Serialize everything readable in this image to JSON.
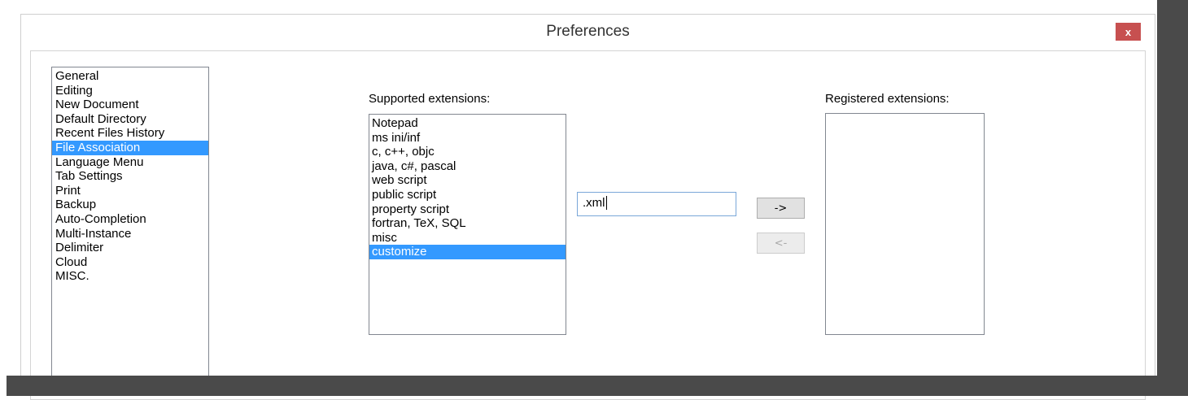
{
  "window": {
    "title": "Preferences",
    "close_label": "x",
    "close_color": "#c75050",
    "selection_color": "#3399ff"
  },
  "categories": {
    "items": [
      {
        "label": "General",
        "selected": false
      },
      {
        "label": "Editing",
        "selected": false
      },
      {
        "label": "New Document",
        "selected": false
      },
      {
        "label": "Default Directory",
        "selected": false
      },
      {
        "label": "Recent Files History",
        "selected": false
      },
      {
        "label": "File Association",
        "selected": true
      },
      {
        "label": "Language Menu",
        "selected": false
      },
      {
        "label": "Tab Settings",
        "selected": false
      },
      {
        "label": "Print",
        "selected": false
      },
      {
        "label": "Backup",
        "selected": false
      },
      {
        "label": "Auto-Completion",
        "selected": false
      },
      {
        "label": "Multi-Instance",
        "selected": false
      },
      {
        "label": "Delimiter",
        "selected": false
      },
      {
        "label": "Cloud",
        "selected": false
      },
      {
        "label": "MISC.",
        "selected": false
      }
    ]
  },
  "supported": {
    "label": "Supported extensions:",
    "items": [
      {
        "label": "Notepad",
        "selected": false
      },
      {
        "label": "ms ini/inf",
        "selected": false
      },
      {
        "label": "c, c++, objc",
        "selected": false
      },
      {
        "label": "java, c#, pascal",
        "selected": false
      },
      {
        "label": "web script",
        "selected": false
      },
      {
        "label": "public script",
        "selected": false
      },
      {
        "label": "property script",
        "selected": false
      },
      {
        "label": "fortran, TeX, SQL",
        "selected": false
      },
      {
        "label": "misc",
        "selected": false
      },
      {
        "label": "customize",
        "selected": true
      }
    ]
  },
  "registered": {
    "label": "Registered extensions:",
    "items": []
  },
  "extension_input": {
    "value": ".xml"
  },
  "buttons": {
    "add_label": "->",
    "remove_label": "<-"
  }
}
